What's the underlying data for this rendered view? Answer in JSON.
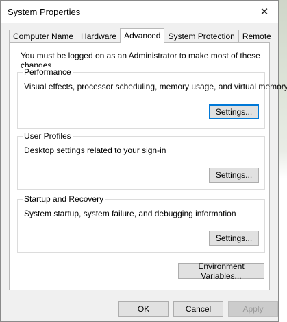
{
  "window": {
    "title": "System Properties",
    "close_glyph": "✕"
  },
  "tabs": [
    {
      "label": "Computer Name",
      "active": false
    },
    {
      "label": "Hardware",
      "active": false
    },
    {
      "label": "Advanced",
      "active": true
    },
    {
      "label": "System Protection",
      "active": false
    },
    {
      "label": "Remote",
      "active": false
    }
  ],
  "notice": "You must be logged on as an Administrator to make most of these changes.",
  "performance": {
    "label": "Performance",
    "description": "Visual effects, processor scheduling, memory usage, and virtual memory",
    "button": "Settings..."
  },
  "user_profiles": {
    "label": "User Profiles",
    "description": "Desktop settings related to your sign-in",
    "button": "Settings..."
  },
  "startup_recovery": {
    "label": "Startup and Recovery",
    "description": "System startup, system failure, and debugging information",
    "button": "Settings..."
  },
  "environment_button": "Environment Variables...",
  "footer": {
    "ok": "OK",
    "cancel": "Cancel",
    "apply": "Apply"
  },
  "colors": {
    "focus_border": "#0078d7",
    "dialog_bg": "#f0f0f0"
  }
}
